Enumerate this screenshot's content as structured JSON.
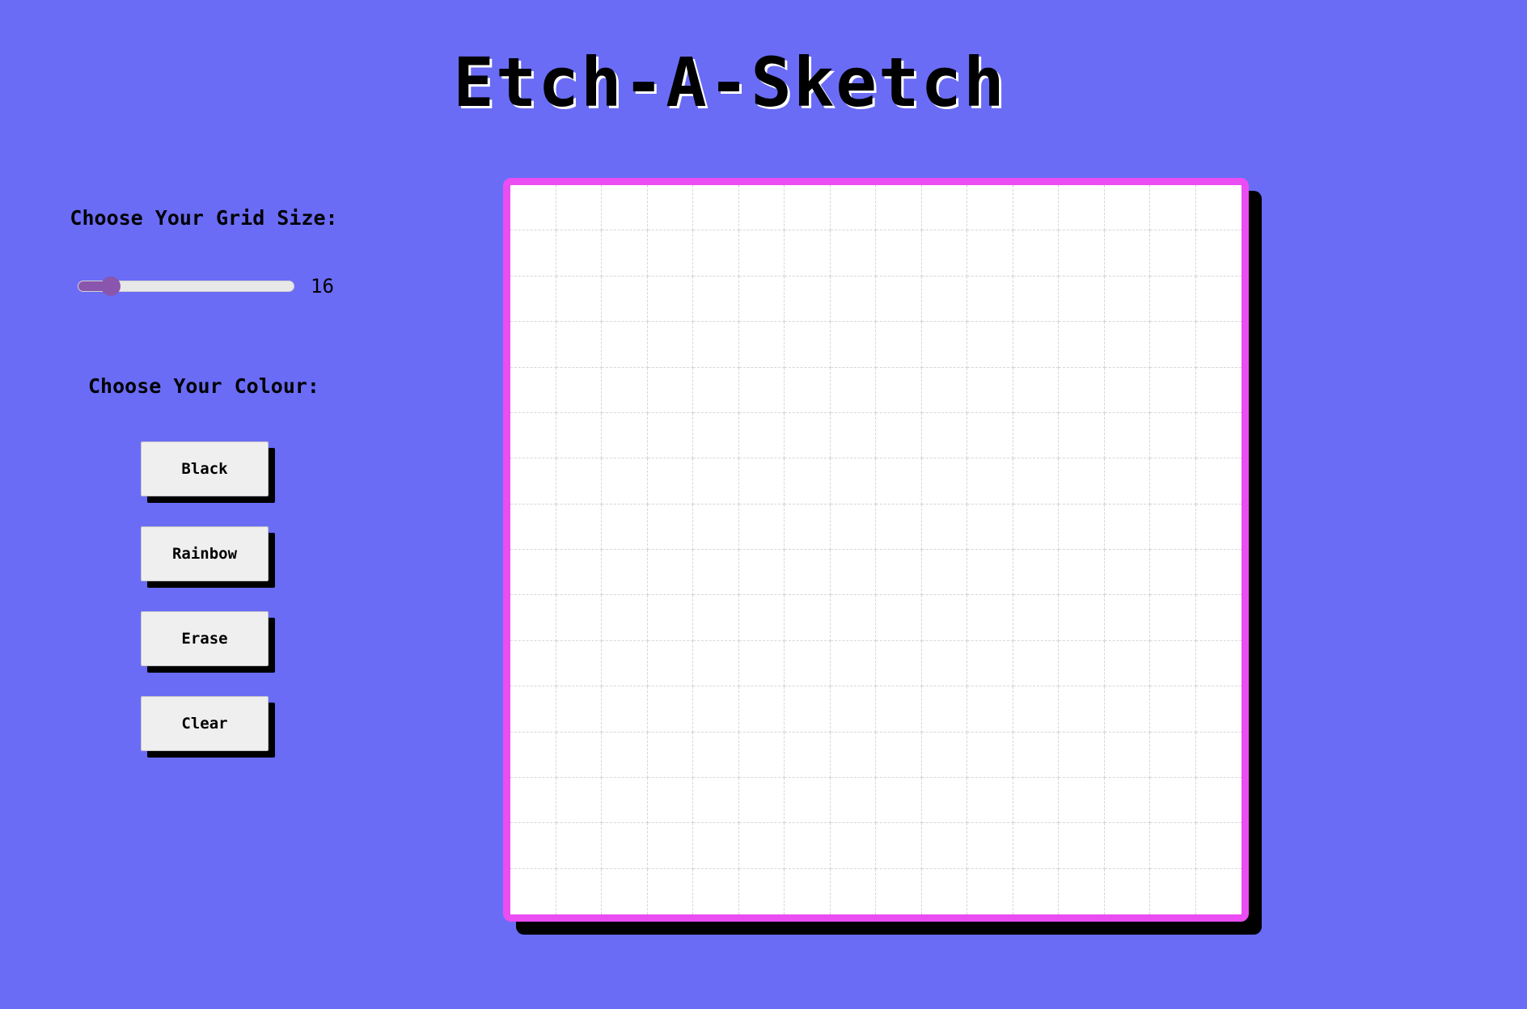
{
  "title": "Etch-A-Sketch",
  "controls": {
    "grid_size_label": "Choose Your Grid Size:",
    "grid_size": {
      "min": 1,
      "max": 100,
      "value": 16,
      "display_value": "16"
    },
    "colour_label": "Choose Your Colour:",
    "buttons": [
      {
        "label": "Black"
      },
      {
        "label": "Rainbow"
      },
      {
        "label": "Erase"
      },
      {
        "label": "Clear"
      }
    ]
  },
  "sketch_pad": {
    "grid_columns": 16,
    "grid_rows": 16,
    "background_color": "#ffffff",
    "grid_line_color": "#d6d6d6"
  },
  "colors": {
    "page_background": "#6a6cf6",
    "board_border": "#ea4df2",
    "slider_accent": "#8a55ad",
    "button_background": "#efefef",
    "shadow": "#000000"
  }
}
